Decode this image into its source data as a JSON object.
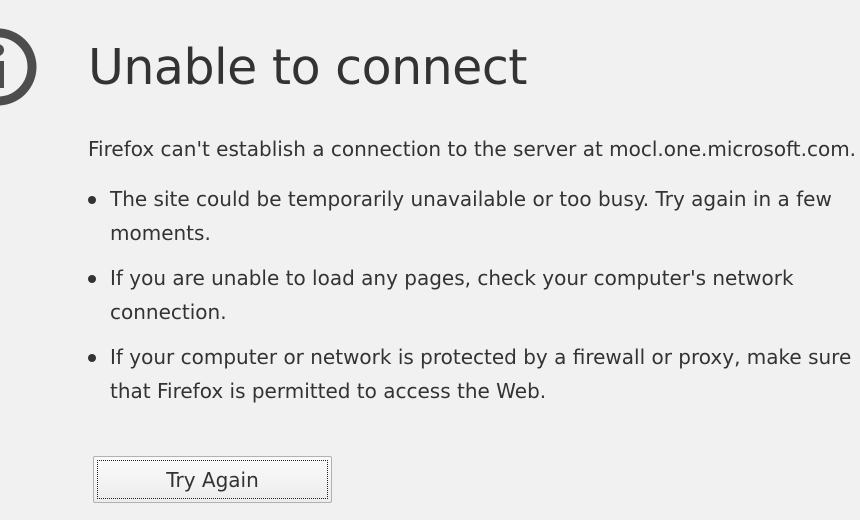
{
  "icon": "info-icon",
  "title": "Unable to connect",
  "description": "Firefox can't establish a connection to the server at mocl.one.microsoft.com.",
  "reasons": [
    "The site could be temporarily unavailable or too busy. Try again in a few moments.",
    "If you are unable to load any pages, check your computer's network connection.",
    "If your computer or network is protected by a firewall or proxy, make sure that Firefox is permitted to access the Web."
  ],
  "button": {
    "label": "Try Again"
  },
  "colors": {
    "background": "#f1f1f1",
    "text": "#333333",
    "icon": "#4d4d4d"
  }
}
